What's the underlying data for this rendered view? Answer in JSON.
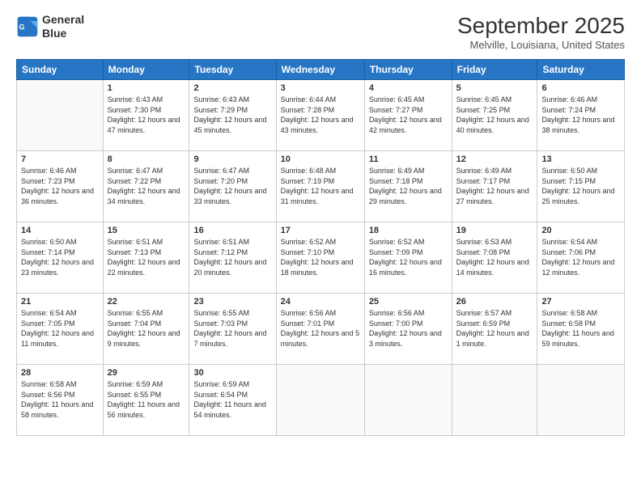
{
  "header": {
    "logo_line1": "General",
    "logo_line2": "Blue",
    "month_title": "September 2025",
    "location": "Melville, Louisiana, United States"
  },
  "weekdays": [
    "Sunday",
    "Monday",
    "Tuesday",
    "Wednesday",
    "Thursday",
    "Friday",
    "Saturday"
  ],
  "weeks": [
    [
      {
        "day": null
      },
      {
        "day": "1",
        "sunrise": "6:43 AM",
        "sunset": "7:30 PM",
        "daylight": "12 hours and 47 minutes."
      },
      {
        "day": "2",
        "sunrise": "6:43 AM",
        "sunset": "7:29 PM",
        "daylight": "12 hours and 45 minutes."
      },
      {
        "day": "3",
        "sunrise": "6:44 AM",
        "sunset": "7:28 PM",
        "daylight": "12 hours and 43 minutes."
      },
      {
        "day": "4",
        "sunrise": "6:45 AM",
        "sunset": "7:27 PM",
        "daylight": "12 hours and 42 minutes."
      },
      {
        "day": "5",
        "sunrise": "6:45 AM",
        "sunset": "7:25 PM",
        "daylight": "12 hours and 40 minutes."
      },
      {
        "day": "6",
        "sunrise": "6:46 AM",
        "sunset": "7:24 PM",
        "daylight": "12 hours and 38 minutes."
      }
    ],
    [
      {
        "day": "7",
        "sunrise": "6:46 AM",
        "sunset": "7:23 PM",
        "daylight": "12 hours and 36 minutes."
      },
      {
        "day": "8",
        "sunrise": "6:47 AM",
        "sunset": "7:22 PM",
        "daylight": "12 hours and 34 minutes."
      },
      {
        "day": "9",
        "sunrise": "6:47 AM",
        "sunset": "7:20 PM",
        "daylight": "12 hours and 33 minutes."
      },
      {
        "day": "10",
        "sunrise": "6:48 AM",
        "sunset": "7:19 PM",
        "daylight": "12 hours and 31 minutes."
      },
      {
        "day": "11",
        "sunrise": "6:49 AM",
        "sunset": "7:18 PM",
        "daylight": "12 hours and 29 minutes."
      },
      {
        "day": "12",
        "sunrise": "6:49 AM",
        "sunset": "7:17 PM",
        "daylight": "12 hours and 27 minutes."
      },
      {
        "day": "13",
        "sunrise": "6:50 AM",
        "sunset": "7:15 PM",
        "daylight": "12 hours and 25 minutes."
      }
    ],
    [
      {
        "day": "14",
        "sunrise": "6:50 AM",
        "sunset": "7:14 PM",
        "daylight": "12 hours and 23 minutes."
      },
      {
        "day": "15",
        "sunrise": "6:51 AM",
        "sunset": "7:13 PM",
        "daylight": "12 hours and 22 minutes."
      },
      {
        "day": "16",
        "sunrise": "6:51 AM",
        "sunset": "7:12 PM",
        "daylight": "12 hours and 20 minutes."
      },
      {
        "day": "17",
        "sunrise": "6:52 AM",
        "sunset": "7:10 PM",
        "daylight": "12 hours and 18 minutes."
      },
      {
        "day": "18",
        "sunrise": "6:52 AM",
        "sunset": "7:09 PM",
        "daylight": "12 hours and 16 minutes."
      },
      {
        "day": "19",
        "sunrise": "6:53 AM",
        "sunset": "7:08 PM",
        "daylight": "12 hours and 14 minutes."
      },
      {
        "day": "20",
        "sunrise": "6:54 AM",
        "sunset": "7:06 PM",
        "daylight": "12 hours and 12 minutes."
      }
    ],
    [
      {
        "day": "21",
        "sunrise": "6:54 AM",
        "sunset": "7:05 PM",
        "daylight": "12 hours and 11 minutes."
      },
      {
        "day": "22",
        "sunrise": "6:55 AM",
        "sunset": "7:04 PM",
        "daylight": "12 hours and 9 minutes."
      },
      {
        "day": "23",
        "sunrise": "6:55 AM",
        "sunset": "7:03 PM",
        "daylight": "12 hours and 7 minutes."
      },
      {
        "day": "24",
        "sunrise": "6:56 AM",
        "sunset": "7:01 PM",
        "daylight": "12 hours and 5 minutes."
      },
      {
        "day": "25",
        "sunrise": "6:56 AM",
        "sunset": "7:00 PM",
        "daylight": "12 hours and 3 minutes."
      },
      {
        "day": "26",
        "sunrise": "6:57 AM",
        "sunset": "6:59 PM",
        "daylight": "12 hours and 1 minute."
      },
      {
        "day": "27",
        "sunrise": "6:58 AM",
        "sunset": "6:58 PM",
        "daylight": "11 hours and 59 minutes."
      }
    ],
    [
      {
        "day": "28",
        "sunrise": "6:58 AM",
        "sunset": "6:56 PM",
        "daylight": "11 hours and 58 minutes."
      },
      {
        "day": "29",
        "sunrise": "6:59 AM",
        "sunset": "6:55 PM",
        "daylight": "11 hours and 56 minutes."
      },
      {
        "day": "30",
        "sunrise": "6:59 AM",
        "sunset": "6:54 PM",
        "daylight": "11 hours and 54 minutes."
      },
      {
        "day": null
      },
      {
        "day": null
      },
      {
        "day": null
      },
      {
        "day": null
      }
    ]
  ]
}
